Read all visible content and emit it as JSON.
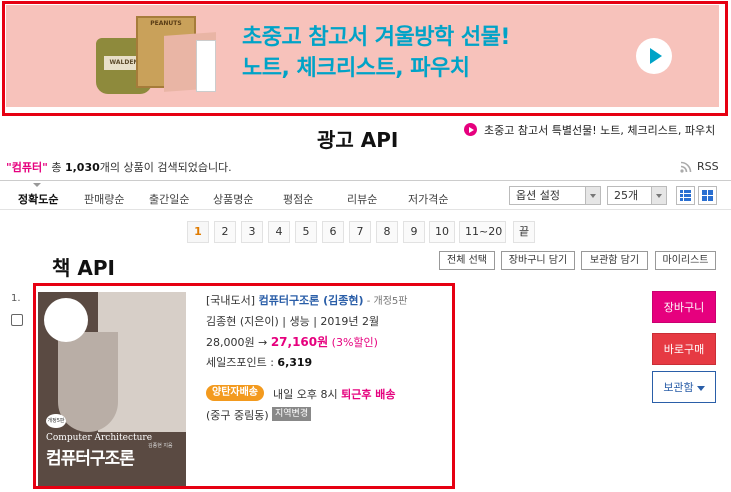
{
  "ad": {
    "headline_line1": "초중고 참고서 겨울방학 선물!",
    "headline_line2": "노트, 체크리스트, 파우치",
    "bag_label": "WALDEN",
    "box_label": "PEANUTS",
    "play_icon": "play-icon",
    "accent_color": "#00a3c7",
    "background_color": "#f7c2bb"
  },
  "annotations": {
    "ad_api": "광고 API",
    "book_api": "책 API"
  },
  "ad_link": {
    "text": "초중고 참고서 특별선물! 노트, 체크리스트, 파우치"
  },
  "summary": {
    "keyword": "\"컴퓨터\"",
    "prefix": " 총 ",
    "count": "1,030",
    "suffix": "개의 상품이 검색되었습니다."
  },
  "rss": {
    "label": "RSS"
  },
  "sort": {
    "items": [
      "정확도순",
      "판매량순",
      "출간일순",
      "상품명순",
      "평점순",
      "리뷰순",
      "저가격순"
    ],
    "option_select": "옵션 설정",
    "per_page": "25개"
  },
  "pagination": {
    "pages": [
      "1",
      "2",
      "3",
      "4",
      "5",
      "6",
      "7",
      "8",
      "9",
      "10"
    ],
    "next_range": "11~20",
    "last": "끝",
    "current": "1"
  },
  "actions": {
    "select_all": "전체 선택",
    "add_cart": "장바구니 담기",
    "add_keep": "보관함 담기",
    "my_list": "마이리스트"
  },
  "book": {
    "number": "1.",
    "category": "[국내도서]",
    "title": "컴퓨터구조론 (김종현)",
    "edition": " - 개정5판",
    "meta": "김종현 (지은이) | 생능 | 2019년 2월",
    "list_price": "28,000원 → ",
    "sale_price": "27,160원",
    "discount": " (3%할인)",
    "point_label": "세일즈포인트 : ",
    "point_value": "6,319",
    "badge": "양탄자배송",
    "delivery_prefix": "내일 오후 8시 ",
    "delivery_em": "퇴근후 배송",
    "region": "(중구 중림동)",
    "region_change": "지역변경",
    "cover": {
      "edition_mark": "개정5판",
      "title_en": "Computer Architecture",
      "title_ko": "컴퓨터구조론",
      "author": "김종현 지음"
    }
  },
  "buttons": {
    "cart": "장바구니",
    "buy_now": "바로구매",
    "keep": "보관함"
  }
}
